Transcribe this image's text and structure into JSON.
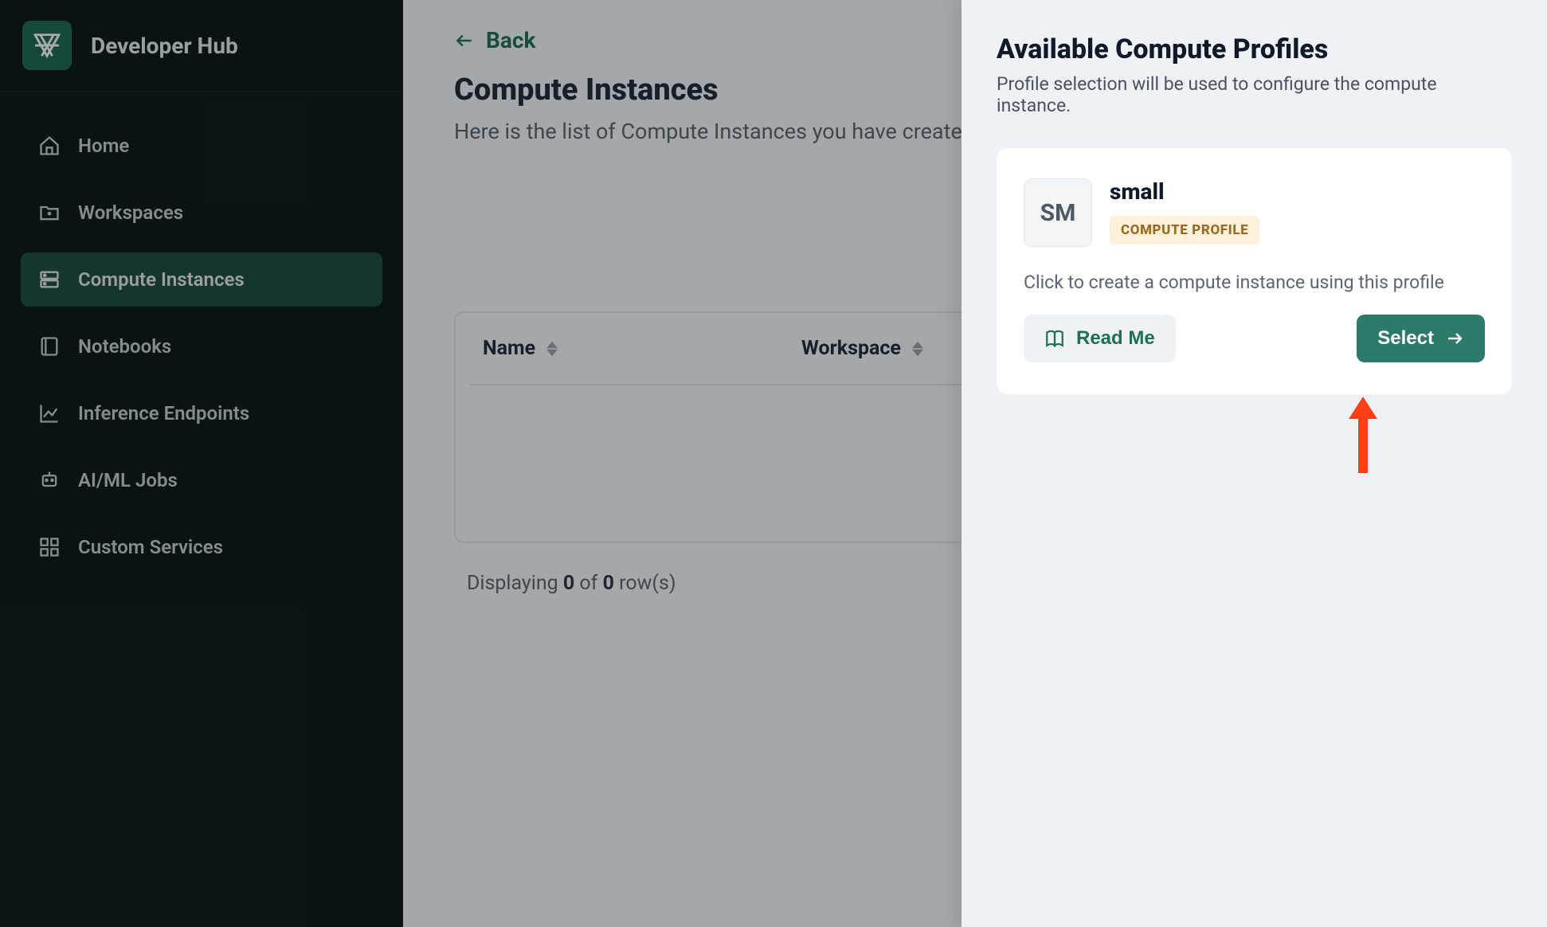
{
  "app": {
    "title": "Developer Hub"
  },
  "sidebar": {
    "items": [
      {
        "label": "Home"
      },
      {
        "label": "Workspaces"
      },
      {
        "label": "Compute Instances"
      },
      {
        "label": "Notebooks"
      },
      {
        "label": "Inference Endpoints"
      },
      {
        "label": "AI/ML Jobs"
      },
      {
        "label": "Custom Services"
      }
    ],
    "active_index": 2
  },
  "main": {
    "back_label": "Back",
    "title": "Compute Instances",
    "subtitle": "Here is the list of Compute Instances you have created.",
    "columns": {
      "name": "Name",
      "workspace": "Workspace"
    },
    "row_summary": {
      "prefix": "Displaying ",
      "count_shown": "0",
      "of": " of ",
      "count_total": "0",
      "suffix": " row(s)"
    }
  },
  "drawer": {
    "title": "Available Compute Profiles",
    "subtitle": "Profile selection will be used to configure the compute instance.",
    "profile": {
      "avatar_text": "SM",
      "name": "small",
      "tag": "COMPUTE PROFILE",
      "description": "Click to create a compute instance using this profile",
      "readme_label": "Read Me",
      "select_label": "Select"
    }
  }
}
